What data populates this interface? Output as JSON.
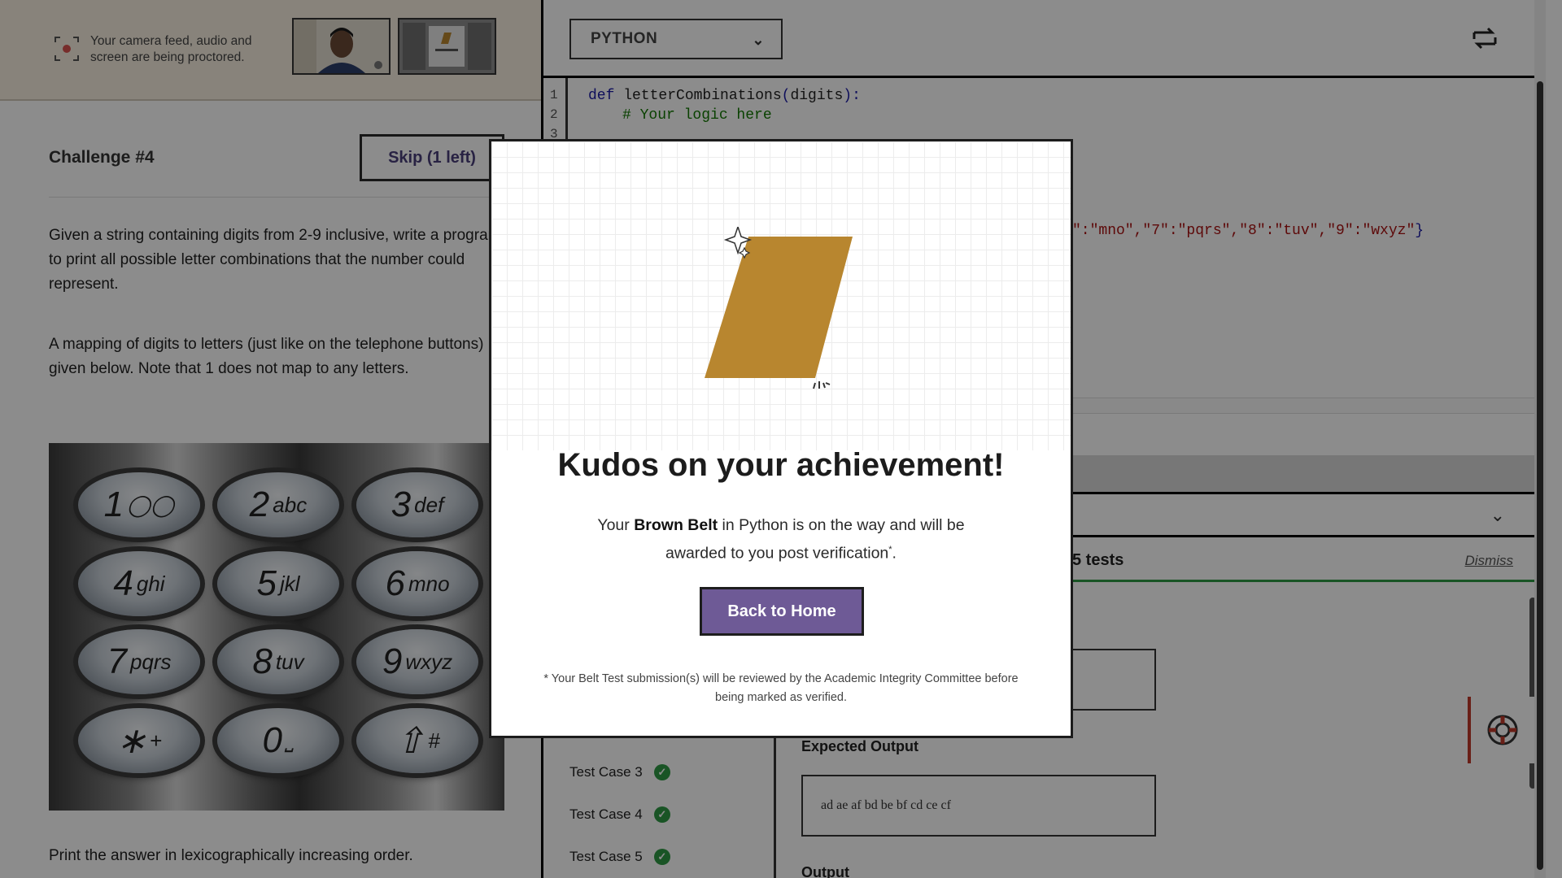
{
  "proctor": {
    "notice": "Your camera feed, audio and screen are being proctored."
  },
  "challenge": {
    "title": "Challenge #4",
    "skip_label": "Skip (1 left)",
    "paragraph1": "Given a string containing digits from 2-9 inclusive, write a program to print all possible letter combinations that the number could represent.",
    "paragraph2": "A mapping of digits to letters (just like on the telephone buttons) is given below. Note that 1 does not map to any letters.",
    "bottom_note": "Print the answer in lexicographically increasing order."
  },
  "keypad": [
    {
      "num": "1",
      "letters": "◯◯"
    },
    {
      "num": "2",
      "letters": "abc"
    },
    {
      "num": "3",
      "letters": "def"
    },
    {
      "num": "4",
      "letters": "ghi"
    },
    {
      "num": "5",
      "letters": "jkl"
    },
    {
      "num": "6",
      "letters": "mno"
    },
    {
      "num": "7",
      "letters": "pqrs"
    },
    {
      "num": "8",
      "letters": "tuv"
    },
    {
      "num": "9",
      "letters": "wxyz"
    },
    {
      "num": "∗",
      "letters": "+"
    },
    {
      "num": "0",
      "letters": "⎵"
    },
    {
      "num": "⇧",
      "letters": "#"
    }
  ],
  "editor": {
    "language": "PYTHON",
    "line_numbers": [
      "1",
      "2",
      "3"
    ],
    "line1_kw": "def",
    "line1_name": " letterCombinations",
    "line1_open": "(",
    "line1_arg": "digits",
    "line1_close": "):",
    "line2_comment": "# Your logic here",
    "mapping_tail": "\":\"mno\",\"7\":\"pqrs\",\"8\":\"tuv\",\"9\":\"wxyz\"",
    "mapping_close": "}"
  },
  "results": {
    "pass_text": "5 tests",
    "dismiss_label": "Dismiss",
    "tests": [
      {
        "label": "Test Case 3"
      },
      {
        "label": "Test Case 4"
      },
      {
        "label": "Test Case 5"
      }
    ],
    "expected_label": "Expected Output",
    "expected_value": "ad ae af bd be bf cd ce cf",
    "output_label": "Output"
  },
  "modal": {
    "title": "Kudos on your achievement!",
    "body_prefix": "Your ",
    "belt_name": "Brown Belt",
    "body_suffix": " in Python is on the way and will be awarded to you post verification",
    "asterisk": "*",
    "body_end": ".",
    "button_label": "Back to Home",
    "footnote": "* Your Belt Test submission(s) will be reviewed by the Academic Integrity Committee before being marked as verified.",
    "belt_color": "#b8862f"
  }
}
